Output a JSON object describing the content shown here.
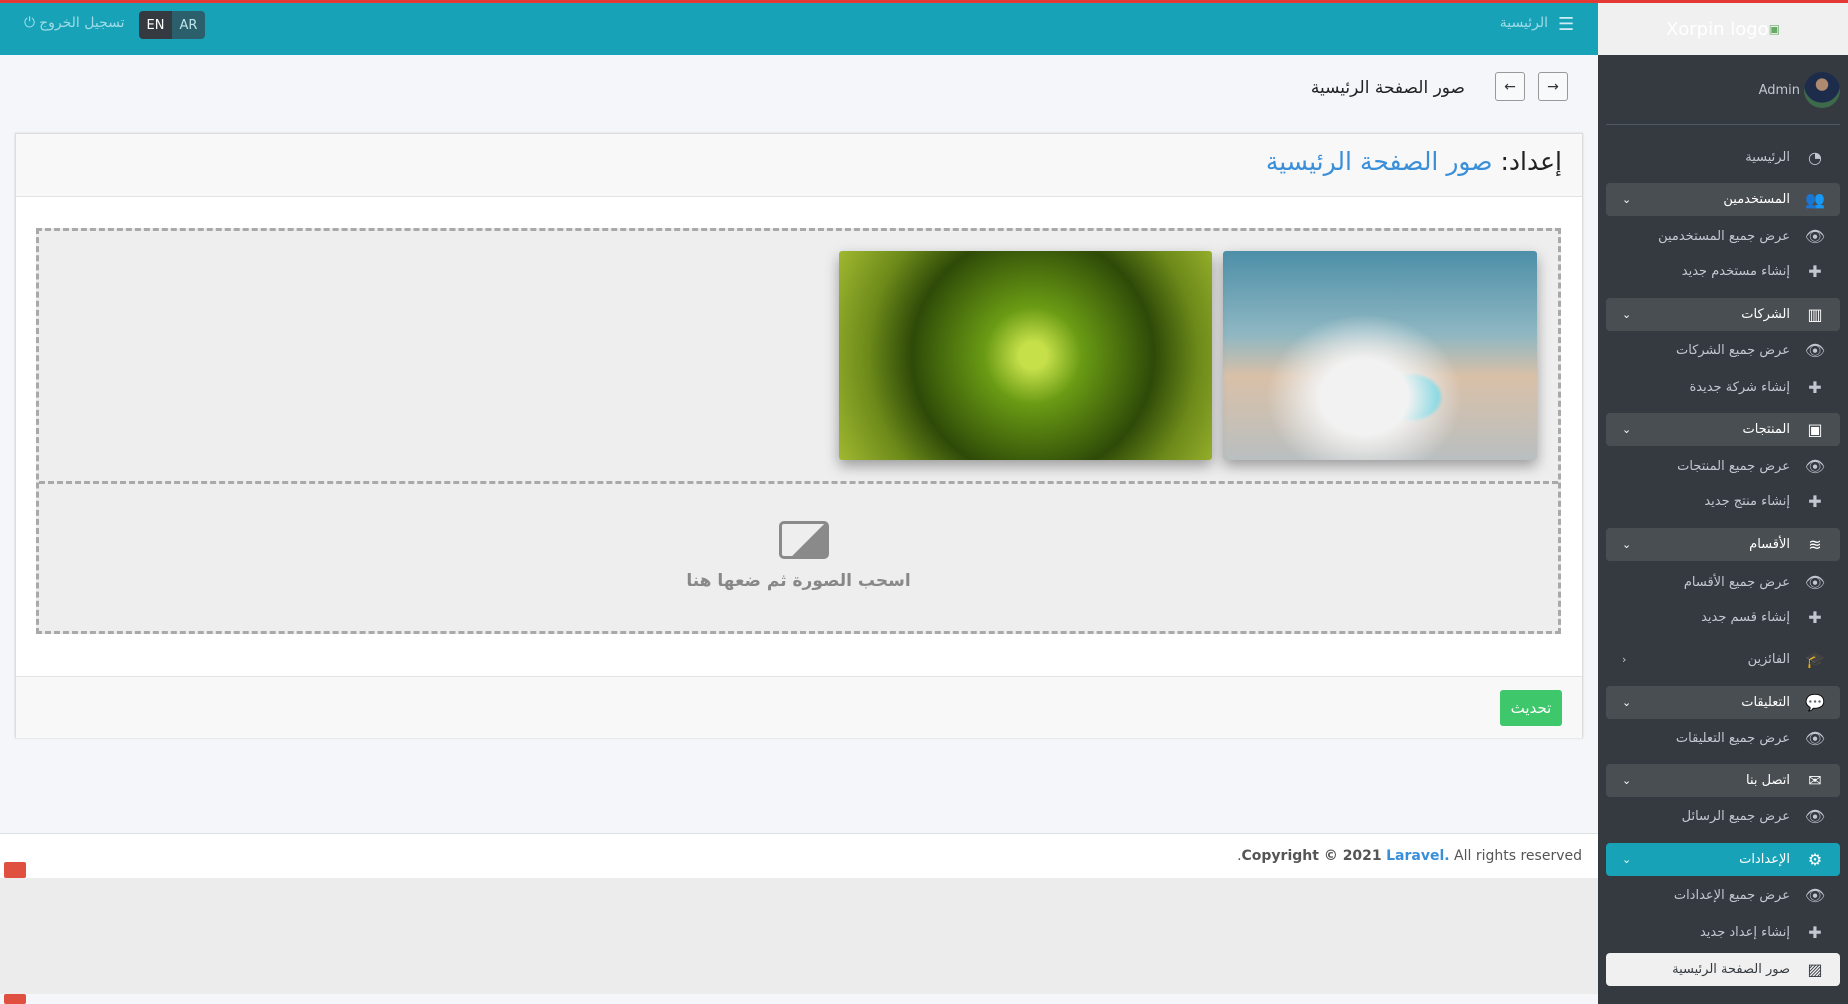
{
  "header": {
    "home_link": "الرئيسية",
    "logout": "تسجيل الخروج",
    "lang": [
      "EN",
      "AR"
    ]
  },
  "colors": {
    "header": "#17a2b8",
    "sidebar": "#343a40",
    "accent_active": "#17a2b8",
    "update_button": "#3ec76b",
    "link": "#3a8fd9"
  },
  "sidebar": {
    "logo_alt": "Xorpin logo",
    "user": "Admin",
    "items": [
      {
        "label": "الرئيسية",
        "icon": "tachometer-icon",
        "type": "link"
      },
      {
        "label": "المستخدمين",
        "icon": "users-icon",
        "type": "open"
      },
      {
        "label": "عرض جميع المستخدمين",
        "icon": "eye-icon",
        "type": "sub"
      },
      {
        "label": "إنشاء مستخدم جديد",
        "icon": "plus-icon",
        "type": "sub"
      },
      {
        "label": "الشركات",
        "icon": "building-icon",
        "type": "open"
      },
      {
        "label": "عرض جميع الشركات",
        "icon": "eye-icon",
        "type": "sub"
      },
      {
        "label": "إنشاء شركة جديدة",
        "icon": "plus-icon",
        "type": "sub"
      },
      {
        "label": "المنتجات",
        "icon": "box-open-icon",
        "type": "open"
      },
      {
        "label": "عرض جميع المنتجات",
        "icon": "eye-icon",
        "type": "sub"
      },
      {
        "label": "إنشاء منتج جديد",
        "icon": "plus-icon",
        "type": "sub"
      },
      {
        "label": "الأقسام",
        "icon": "layers-icon",
        "type": "open"
      },
      {
        "label": "عرض جميع الأقسام",
        "icon": "eye-icon",
        "type": "sub"
      },
      {
        "label": "إنشاء قسم جديد",
        "icon": "plus-icon",
        "type": "sub"
      },
      {
        "label": "الفائزين",
        "icon": "graduation-cap-icon",
        "type": "closed"
      },
      {
        "label": "التعليقات",
        "icon": "comments-icon",
        "type": "open"
      },
      {
        "label": "عرض جميع التعليقات",
        "icon": "eye-icon",
        "type": "sub"
      },
      {
        "label": "اتصل بنا",
        "icon": "envelope-icon",
        "type": "open"
      },
      {
        "label": "عرض جميع الرسائل",
        "icon": "eye-icon",
        "type": "sub"
      },
      {
        "label": "الإعدادات",
        "icon": "cogs-icon",
        "type": "active"
      },
      {
        "label": "عرض جميع الإعدادات",
        "icon": "eye-icon",
        "type": "sub"
      },
      {
        "label": "إنشاء إعداد جديد",
        "icon": "plus-icon",
        "type": "sub"
      },
      {
        "label": "صور الصفحة الرئيسية",
        "icon": "images-icon",
        "type": "current"
      }
    ]
  },
  "page": {
    "title": "صور الصفحة الرئيسية"
  },
  "card": {
    "title_prefix": "إعداد:",
    "title_highlight": "صور الصفحة الرئيسية",
    "drop_text": "اسحب الصورة ثم ضعها هنا",
    "update_button": "تحديث"
  },
  "footer": {
    "copyright": "Copyright © 2021",
    "brand": "Laravel.",
    "rights": "All rights reserved",
    "dot": "."
  }
}
